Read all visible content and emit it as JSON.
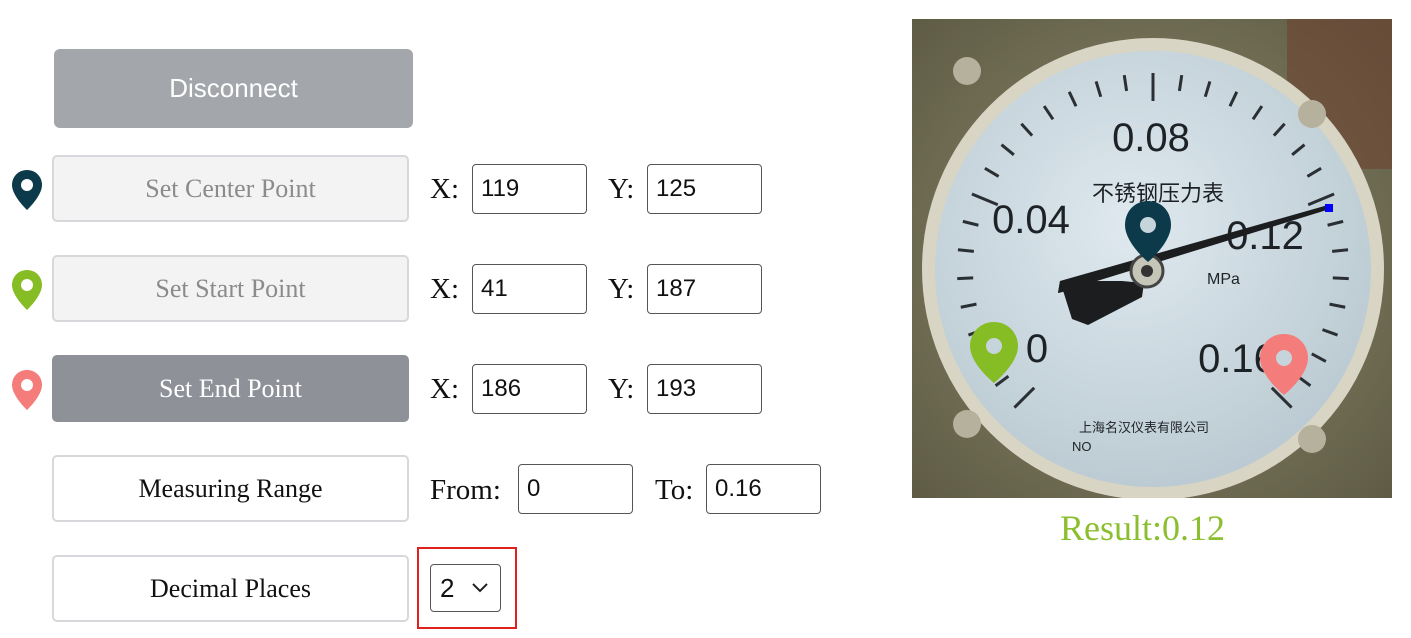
{
  "connection": {
    "disconnect_label": "Disconnect"
  },
  "points": {
    "center": {
      "label": "Set Center Point",
      "x_label": "X:",
      "x": "119",
      "y_label": "Y:",
      "y": "125",
      "pin_color": "#0d3a4a"
    },
    "start": {
      "label": "Set Start Point",
      "x_label": "X:",
      "x": "41",
      "y_label": "Y:",
      "y": "187",
      "pin_color": "#86bd25"
    },
    "end": {
      "label": "Set End Point",
      "x_label": "X:",
      "x": "186",
      "y_label": "Y:",
      "y": "193",
      "pin_color": "#f47c7a"
    }
  },
  "range": {
    "label": "Measuring Range",
    "from_label": "From:",
    "from": "0",
    "to_label": "To:",
    "to": "0.16"
  },
  "decimals": {
    "label": "Decimal Places",
    "selected": "2"
  },
  "gauge": {
    "scale_labels": [
      "0",
      "0.04",
      "0.08",
      "0.12",
      "0.16"
    ],
    "unit": "MPa",
    "dial_text": "不锈钢压力表",
    "maker_text": "上海名汉仪表有限公司",
    "serial_prefix": "NO",
    "reading": 0.12
  },
  "result": {
    "text": "Result:0.12",
    "color": "#8cbf30"
  }
}
